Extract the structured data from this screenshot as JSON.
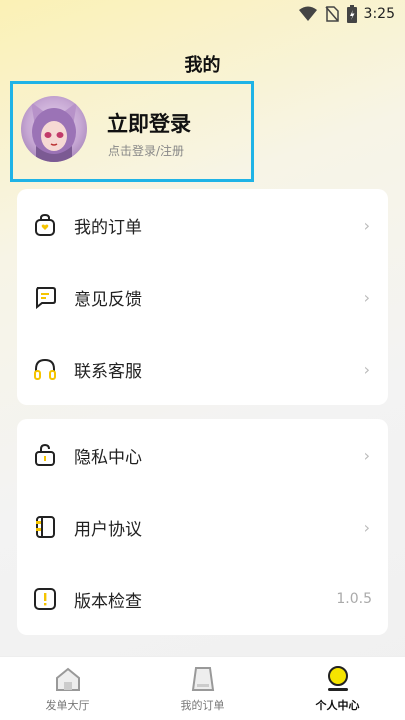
{
  "status_bar": {
    "time": "3:25"
  },
  "page": {
    "title": "我的"
  },
  "profile": {
    "title": "立即登录",
    "subtitle": "点击登录/注册"
  },
  "menu_group_1": [
    {
      "label": "我的订单",
      "icon": "bag-icon"
    },
    {
      "label": "意见反馈",
      "icon": "feedback-icon"
    },
    {
      "label": "联系客服",
      "icon": "headset-icon"
    }
  ],
  "menu_group_2": [
    {
      "label": "隐私中心",
      "icon": "lock-icon"
    },
    {
      "label": "用户协议",
      "icon": "document-icon"
    },
    {
      "label": "版本检查",
      "icon": "alert-icon",
      "value": "1.0.5"
    }
  ],
  "tabbar": [
    {
      "label": "发单大厅",
      "icon": "house-icon",
      "active": false
    },
    {
      "label": "我的订单",
      "icon": "order-icon",
      "active": false
    },
    {
      "label": "个人中心",
      "icon": "person-icon",
      "active": true
    }
  ],
  "colors": {
    "accent": "#f5c400",
    "highlight_border": "#1fb3e6"
  }
}
